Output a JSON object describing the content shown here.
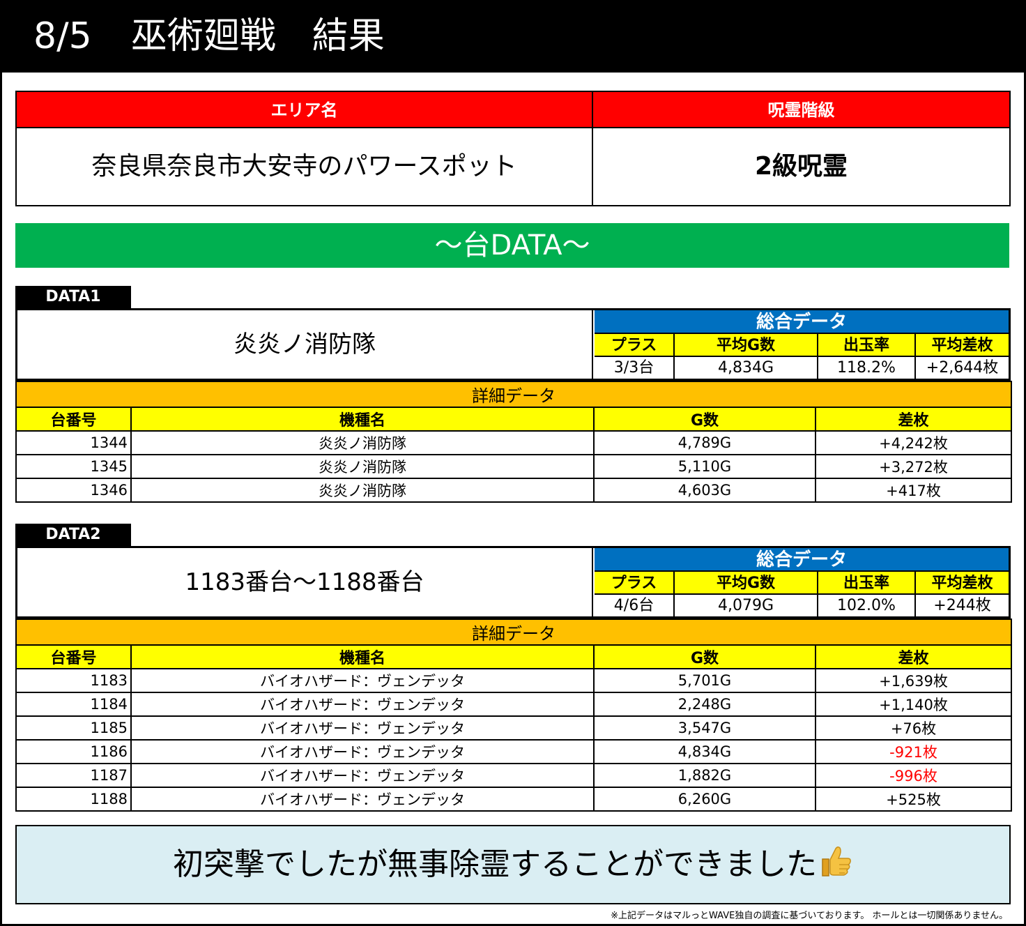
{
  "header": {
    "date": "8/5",
    "title": "巫術廻戦　結果"
  },
  "area": {
    "label_area": "エリア名",
    "label_rank": "呪霊階級",
    "area_name": "奈良県奈良市大安寺のパワースポット",
    "rank": "2級呪霊"
  },
  "section_title": "〜台DATA〜",
  "summary_labels": {
    "header": "総合データ",
    "plus": "プラス",
    "avg_games": "平均G数",
    "payout": "出玉率",
    "avg_diff": "平均差枚"
  },
  "detail_labels": {
    "caption": "詳細データ",
    "no": "台番号",
    "model": "機種名",
    "games": "G数",
    "diff": "差枚"
  },
  "data1": {
    "tag": "DATA1",
    "machine": "炎炎ノ消防隊",
    "summary": {
      "plus": "3/3台",
      "avg_games": "4,834G",
      "payout": "118.2%",
      "avg_diff": "+2,644枚"
    },
    "rows": [
      {
        "no": "1344",
        "model": "炎炎ノ消防隊",
        "games": "4,789G",
        "diff": "+4,242枚",
        "negative": false
      },
      {
        "no": "1345",
        "model": "炎炎ノ消防隊",
        "games": "5,110G",
        "diff": "+3,272枚",
        "negative": false
      },
      {
        "no": "1346",
        "model": "炎炎ノ消防隊",
        "games": "4,603G",
        "diff": "+417枚",
        "negative": false
      }
    ]
  },
  "data2": {
    "tag": "DATA2",
    "machine": "1183番台〜1188番台",
    "summary": {
      "plus": "4/6台",
      "avg_games": "4,079G",
      "payout": "102.0%",
      "avg_diff": "+244枚"
    },
    "rows": [
      {
        "no": "1183",
        "model": "バイオハザード：ヴェンデッタ",
        "games": "5,701G",
        "diff": "+1,639枚",
        "negative": false
      },
      {
        "no": "1184",
        "model": "バイオハザード：ヴェンデッタ",
        "games": "2,248G",
        "diff": "+1,140枚",
        "negative": false
      },
      {
        "no": "1185",
        "model": "バイオハザード：ヴェンデッタ",
        "games": "3,547G",
        "diff": "+76枚",
        "negative": false
      },
      {
        "no": "1186",
        "model": "バイオハザード：ヴェンデッタ",
        "games": "4,834G",
        "diff": "-921枚",
        "negative": true
      },
      {
        "no": "1187",
        "model": "バイオハザード：ヴェンデッタ",
        "games": "1,882G",
        "diff": "-996枚",
        "negative": true
      },
      {
        "no": "1188",
        "model": "バイオハザード：ヴェンデッタ",
        "games": "6,260G",
        "diff": "+525枚",
        "negative": false
      }
    ]
  },
  "message": {
    "text": "初突撃でしたが無事除霊することができました",
    "icon": "thumbs-up-icon"
  },
  "footnote": "※上記データはマルっとWAVE独自の調査に基づいております。 ホールとは一切関係ありません。",
  "colors": {
    "red": "#ff0000",
    "green": "#00b050",
    "blue": "#0070c0",
    "yellow": "#ffff00",
    "orange": "#ffc000",
    "light_blue": "#daeef3"
  }
}
